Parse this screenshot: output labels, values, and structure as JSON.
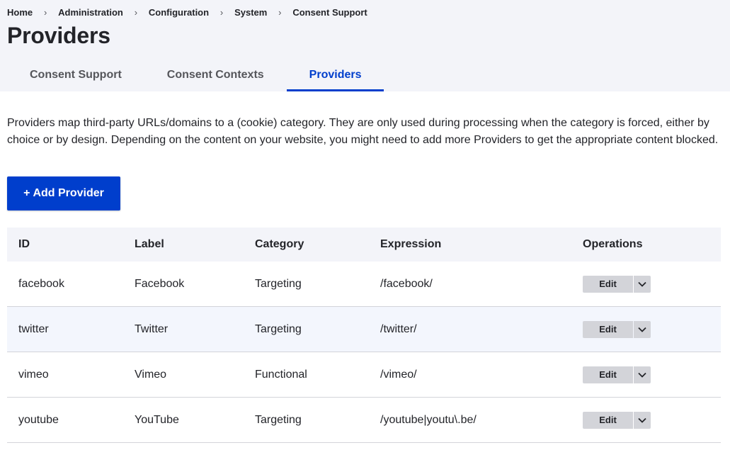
{
  "breadcrumb": [
    "Home",
    "Administration",
    "Configuration",
    "System",
    "Consent Support"
  ],
  "breadcrumb_separator": "›",
  "page": {
    "title": "Providers",
    "description": "Providers map third-party URLs/domains to a (cookie) category. They are only used during processing when the category is forced, either by choice or by design. Depending on the content on your website, you might need to add more Providers to get the appropriate content blocked."
  },
  "tabs": [
    {
      "label": "Consent Support",
      "active": false
    },
    {
      "label": "Consent Contexts",
      "active": false
    },
    {
      "label": "Providers",
      "active": true
    }
  ],
  "add_button": {
    "icon": "+",
    "label": "Add Provider"
  },
  "table": {
    "headers": [
      "ID",
      "Label",
      "Category",
      "Expression",
      "Operations"
    ],
    "rows": [
      {
        "id": "facebook",
        "label": "Facebook",
        "category": "Targeting",
        "expression": "/facebook/",
        "operation": "Edit"
      },
      {
        "id": "twitter",
        "label": "Twitter",
        "category": "Targeting",
        "expression": "/twitter/",
        "operation": "Edit"
      },
      {
        "id": "vimeo",
        "label": "Vimeo",
        "category": "Functional",
        "expression": "/vimeo/",
        "operation": "Edit"
      },
      {
        "id": "youtube",
        "label": "YouTube",
        "category": "Targeting",
        "expression": "/youtube|youtu\\.be/",
        "operation": "Edit"
      }
    ]
  },
  "colors": {
    "accent": "#003ecc",
    "header_bg": "#f3f4f9",
    "row_highlight": "#f3f6fd",
    "dropbutton_bg": "#d3d4d9"
  },
  "icons": {
    "dropdown_toggle": "chevron-down-icon"
  }
}
